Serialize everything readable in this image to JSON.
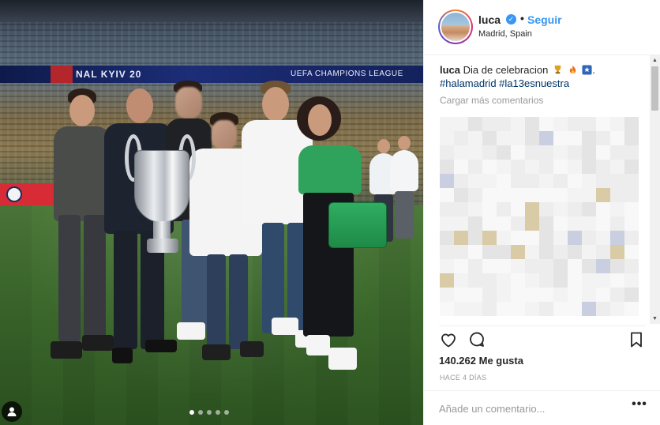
{
  "post": {
    "photo_alt": "Family celebrating with the UEFA Champions League trophy",
    "stadium_banner": "NAL KYIV 20",
    "league_banner": "UEFA CHAMPIONS LEAGUE",
    "carousel": {
      "count": 5,
      "active": 1
    }
  },
  "header": {
    "username": "luca",
    "separator": "•",
    "follow_label": "Seguir",
    "location": "Madrid, Spain"
  },
  "caption": {
    "username": "luca",
    "text": "Dia de celebracion",
    "trailing": ".",
    "hashtag_1": "#halamadrid",
    "hashtag_2": "#la13esnuestra",
    "emojis": [
      "trophy-emoji",
      "fire-emoji",
      "star-emoji"
    ]
  },
  "comments": {
    "load_more_label": "Cargar más comentarios"
  },
  "stats": {
    "likes_count": "140.262",
    "likes_label": "Me gusta",
    "time_ago": "HACE 4 DÍAS"
  },
  "comment_box": {
    "placeholder": "Añade un comentario...",
    "more_label": "•••"
  },
  "colors": {
    "link_blue": "#3897f0",
    "hashtag_blue": "#003569",
    "text": "#262626",
    "muted": "#999999"
  }
}
